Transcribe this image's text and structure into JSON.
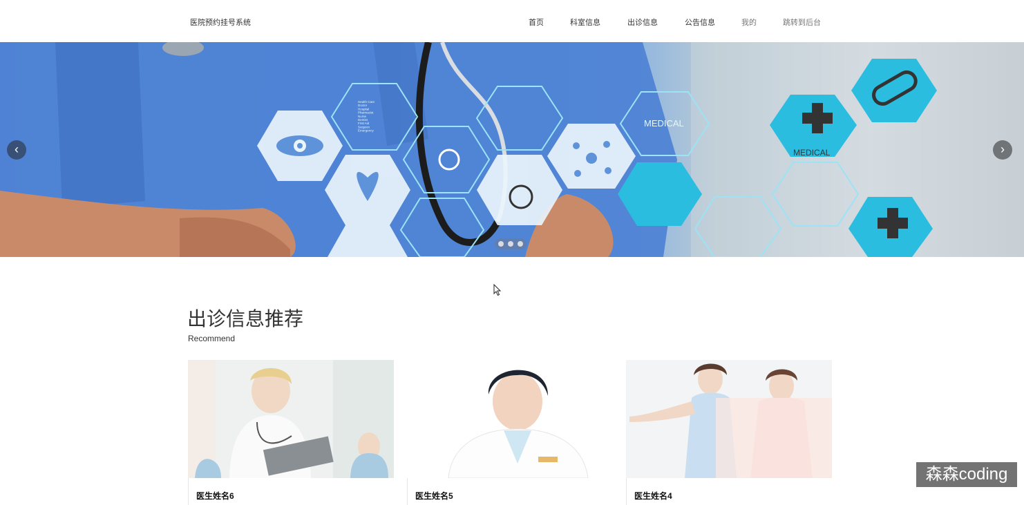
{
  "navbar": {
    "brand": "医院预约挂号系统",
    "items": [
      {
        "label": "首页"
      },
      {
        "label": "科室信息"
      },
      {
        "label": "出诊信息"
      },
      {
        "label": "公告信息"
      },
      {
        "label": "我的"
      },
      {
        "label": "跳转到后台"
      }
    ]
  },
  "banner": {
    "prev_icon": "chevron-left-icon",
    "next_icon": "chevron-right-icon",
    "prev_glyph": "‹",
    "next_glyph": "›",
    "slide_count": 3,
    "active_slide": 1,
    "hex_labels": [
      "MEDICAL",
      "MEDICAL"
    ],
    "hex_text_lines": [
      "Health Care",
      "Doctor",
      "Hospital",
      "Pharmacist",
      "Nurse",
      "Dentist",
      "First Aid",
      "Surgeon",
      "Emergency"
    ]
  },
  "section": {
    "title": "出诊信息推荐",
    "subtitle": "Recommend"
  },
  "doctors": [
    {
      "name": "医生姓名6"
    },
    {
      "name": "医生姓名5"
    },
    {
      "name": "医生姓名4"
    }
  ],
  "watermark": "森森coding",
  "colors": {
    "hex_fill": "#2bbde0",
    "hex_stroke": "#9be3f5",
    "scrub_blue": "#4f83d4",
    "dark_button": "#333333"
  }
}
